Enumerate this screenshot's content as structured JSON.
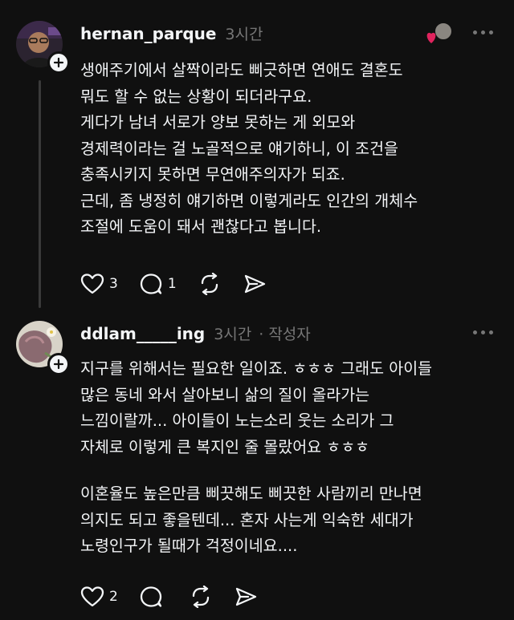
{
  "posts": [
    {
      "username": "hernan_parque",
      "time": "3시간",
      "author_tag": "",
      "lines": [
        "생애주기에서 살짝이라도 삐긋하면 연애도 결혼도",
        "뭐도 할 수 없는 상황이 되더라구요.",
        "게다가 남녀 서로가 양보 못하는 게 외모와",
        "경제력이라는 걸 노골적으로 얘기하니, 이 조건을",
        "충족시키지 못하면 무연애주의자가 되죠.",
        "근데, 좀 냉정히 얘기하면 이렇게라도 인간의 개체수",
        "조절에 도움이 돼서 괜찮다고 봅니다."
      ],
      "likes": "3",
      "replies": "1"
    },
    {
      "username": "ddlam_____ing",
      "time": "3시간",
      "author_tag": "· 작성자",
      "lines": [
        "지구를 위해서는 필요한 일이죠. ㅎㅎㅎ 그래도 아이들",
        "많은 동네 와서 살아보니 삶의 질이 올라가는",
        "느낌이랄까... 아이들이 노는소리 웃는 소리가 그",
        "자체로 이렇게 큰 복지인 줄 몰랐어요 ㅎㅎㅎ",
        "",
        "이혼율도 높은만큼 삐끗해도 삐끗한 사람끼리 만나면",
        "의지도 되고 좋을텐데... 혼자 사는게 익숙한 세대가",
        "노령인구가 될때가 걱정이네요...."
      ],
      "likes": "2",
      "replies": ""
    }
  ],
  "colors": {
    "background": "#101010",
    "text": "#f3f5f7",
    "meta": "#777777",
    "heart": "#e0245e"
  }
}
